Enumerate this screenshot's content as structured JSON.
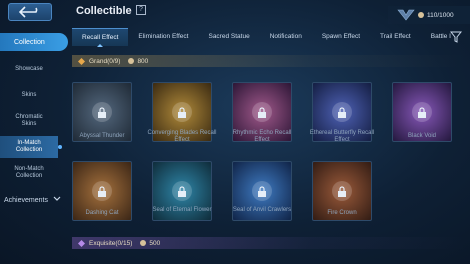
{
  "header": {
    "title": "Collectible",
    "counter": "110/1000"
  },
  "sidebar": {
    "main_label": "Collection",
    "items": [
      "Showcase",
      "Skins",
      "Chromatic Skins",
      "In-Match Collection",
      "Non-Match Collection"
    ],
    "achievements": "Achievements"
  },
  "tabs": [
    "Recall Effect",
    "Elimination Effect",
    "Sacred Statue",
    "Notification",
    "Spawn Effect",
    "Trail Effect",
    "Battle I"
  ],
  "sections": {
    "grand": {
      "label": "Grand(0/9)",
      "points": "800"
    },
    "exquisite": {
      "label": "Exquisite(0/15)",
      "points": "500"
    }
  },
  "items": [
    {
      "name": "Abyssal Thunder",
      "color": "#2b3a4a"
    },
    {
      "name": "Converging Blades Recall Effect",
      "color": "#4a3a1e"
    },
    {
      "name": "Rhythmic Echo Recall Effect",
      "color": "#3a244a"
    },
    {
      "name": "Ethereal Butterfly Recall Effect",
      "color": "#1c2d5a"
    },
    {
      "name": "Black Void",
      "color": "#3a2a55"
    },
    {
      "name": "Dashing Cat",
      "color": "#4a3a24"
    },
    {
      "name": "Seal of Eternal Flower",
      "color": "#16384a"
    },
    {
      "name": "Seal of Anvil Crawlers",
      "color": "#162f55"
    },
    {
      "name": "Fire Crown",
      "color": "#3e2a22"
    }
  ]
}
